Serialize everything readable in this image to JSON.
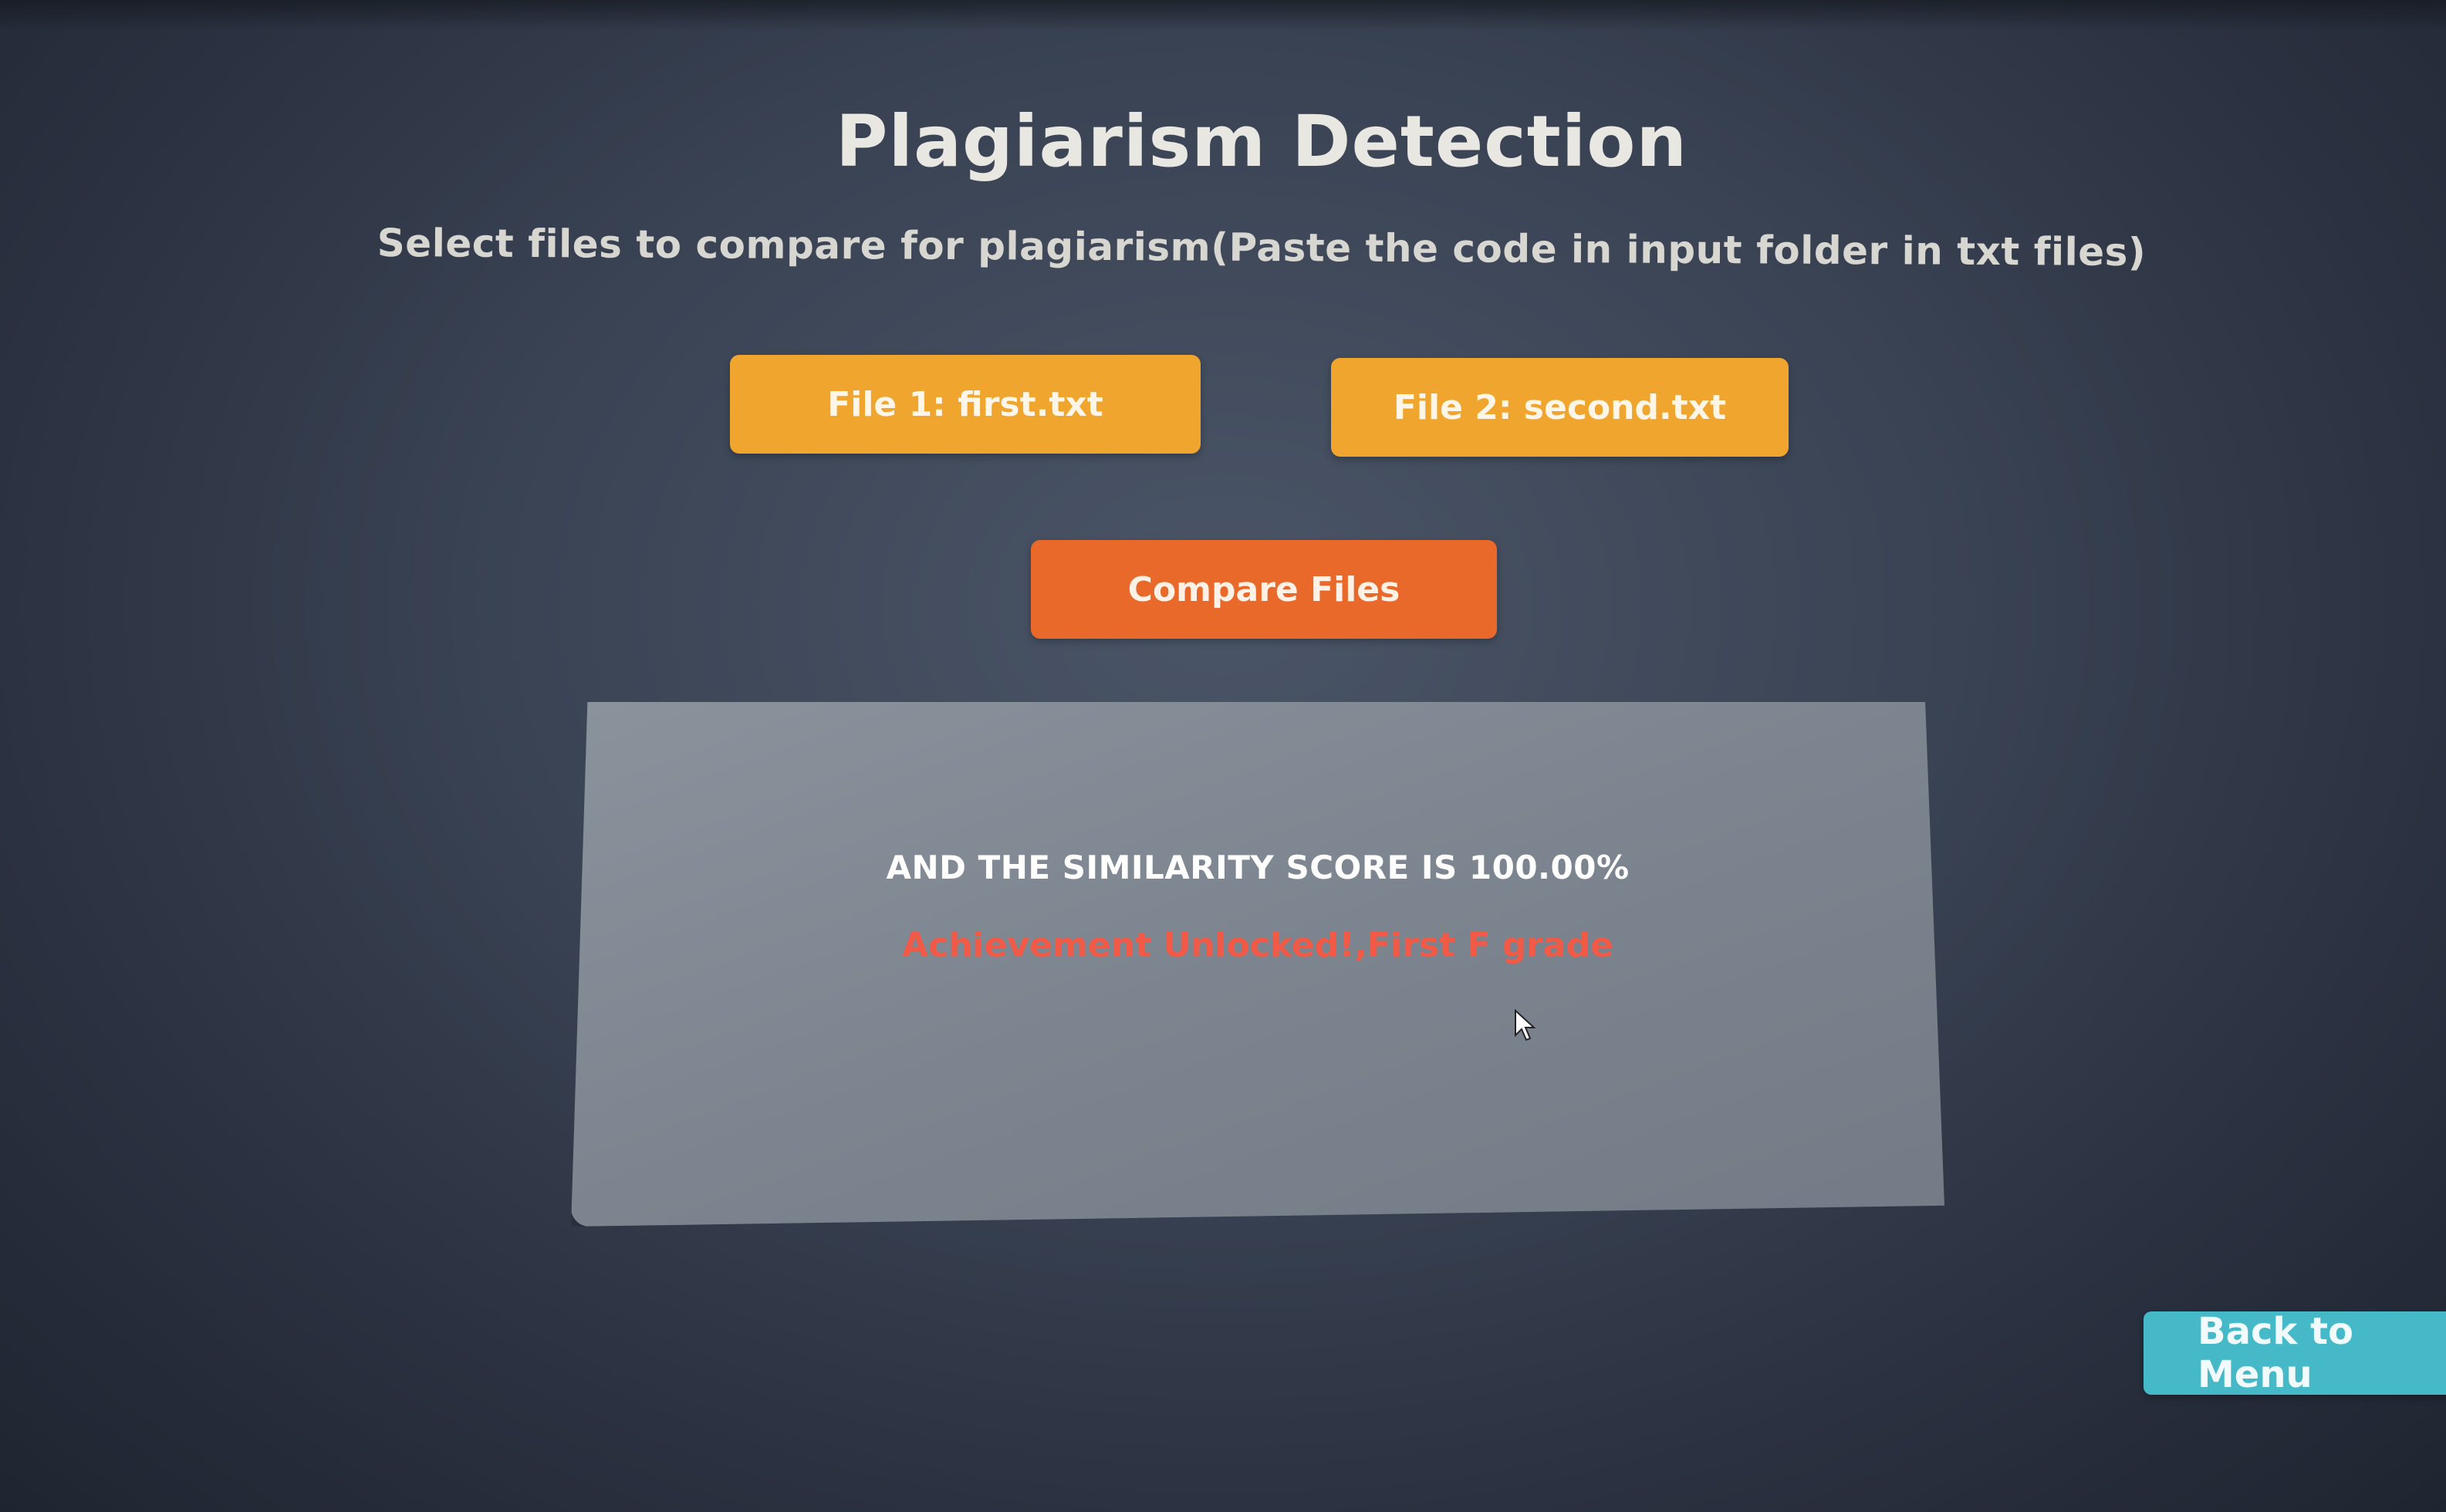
{
  "page": {
    "title": "Plagiarism Detection",
    "subtitle": "Select files to compare for plagiarism(Paste the code in input folder in txt files)"
  },
  "file_buttons": [
    {
      "label": "File 1: first.txt"
    },
    {
      "label": "File 2: second.txt"
    }
  ],
  "compare_button": {
    "label": "Compare Files"
  },
  "result": {
    "score_text": "AND THE SIMILARITY SCORE IS 100.00%",
    "achievement_text": "Achievement Unlocked!,First F grade"
  },
  "back_button": {
    "label": "Back to Menu"
  },
  "colors": {
    "file_button": "#f0a62e",
    "compare_button": "#e8692a",
    "back_button": "#46b9c8",
    "achievement_text": "#f05a46",
    "background": "#3a4354"
  },
  "icons": {
    "cursor": "mouse-pointer-icon"
  }
}
